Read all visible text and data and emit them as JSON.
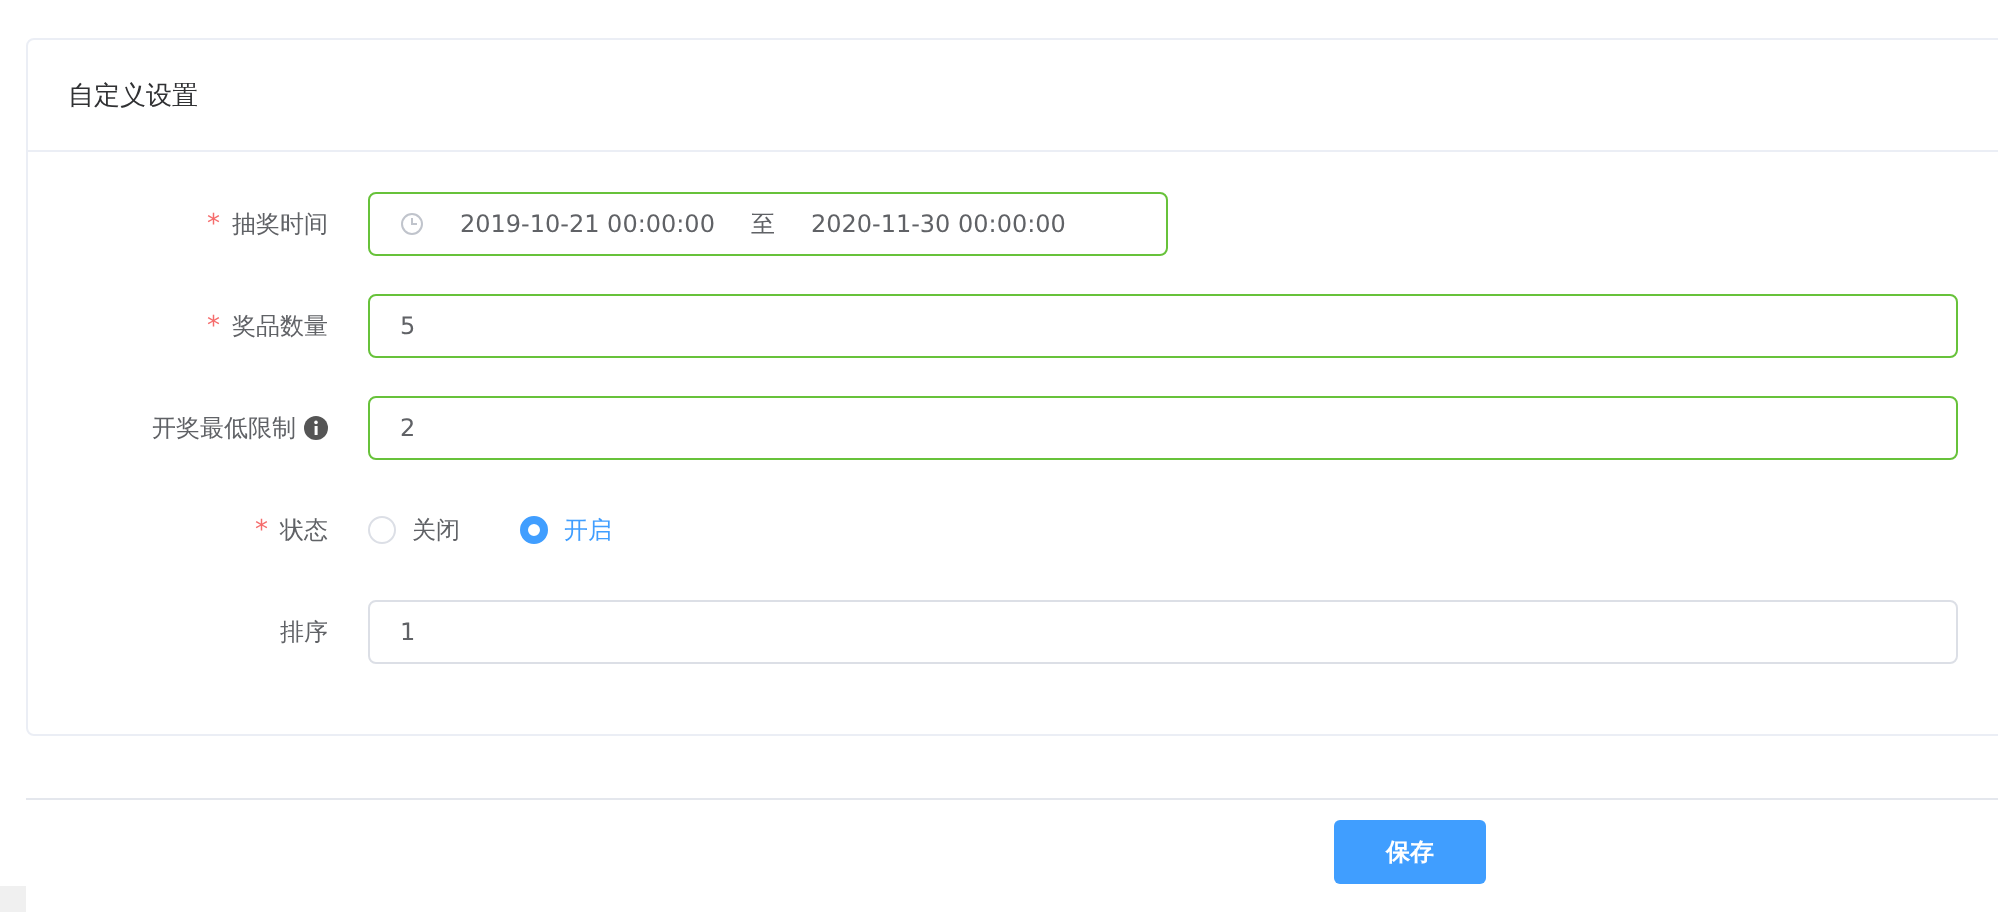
{
  "card": {
    "title": "自定义设置"
  },
  "fields": [
    {
      "kind": "daterange",
      "label": "抽奖时间",
      "required": true,
      "valid": true,
      "start": "2019-10-21 00:00:00",
      "separator": "至",
      "end": "2020-11-30 00:00:00"
    },
    {
      "kind": "input",
      "label": "奖品数量",
      "required": true,
      "valid": true,
      "value": "5"
    },
    {
      "kind": "input",
      "label": "开奖最低限制",
      "required": false,
      "info": true,
      "valid": true,
      "value": "2"
    },
    {
      "kind": "radio",
      "label": "状态",
      "required": true,
      "options": [
        {
          "label": "关闭",
          "selected": false
        },
        {
          "label": "开启",
          "selected": true
        }
      ]
    },
    {
      "kind": "input",
      "label": "排序",
      "required": false,
      "valid": false,
      "value": "1"
    }
  ],
  "required_mark": "*",
  "save_button": "保存"
}
